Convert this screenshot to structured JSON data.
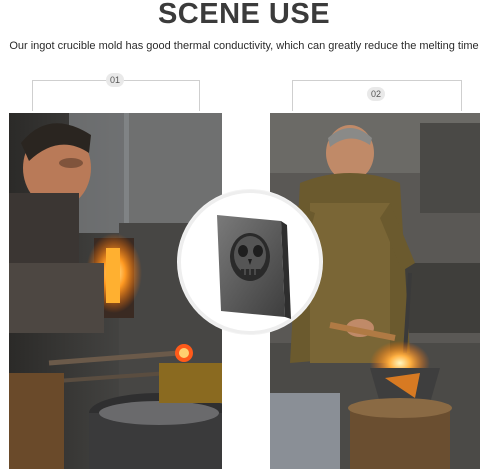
{
  "header": {
    "title": "SCENE USE",
    "subtitle": "Our ingot crucible mold has good thermal conductivity, which can greatly reduce the melting time"
  },
  "labels": {
    "first": "01",
    "second": "02"
  },
  "images": {
    "left": "blacksmith-at-forge-photo",
    "right": "blacksmith-torch-anvil-photo",
    "center": "skull-ingot-mold-product-photo"
  },
  "colors": {
    "title": "#3b3b3b",
    "fire": "#ff8a1c"
  }
}
